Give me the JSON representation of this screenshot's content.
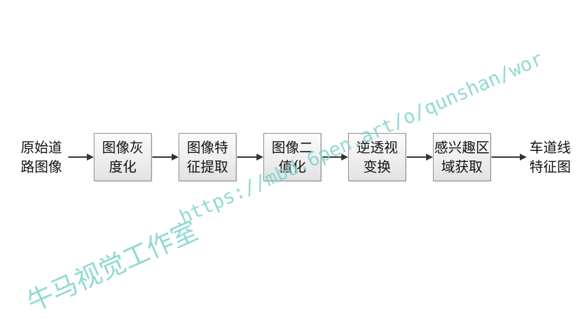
{
  "diagram": {
    "start": {
      "line1": "原始道",
      "line2": "路图像"
    },
    "end": {
      "line1": "车道线",
      "line2": "特征图"
    },
    "steps": [
      {
        "line1": "图像灰",
        "line2": "度化"
      },
      {
        "line1": "图像特",
        "line2": "征提取"
      },
      {
        "line1": "图像二",
        "line2": "值化"
      },
      {
        "line1": "逆透视",
        "line2": "变换"
      },
      {
        "line1": "感兴趣区",
        "line2": "域获取"
      }
    ],
    "colors": {
      "box_border": "#8f8f8f",
      "arrow": "#333333",
      "watermark": "#7fd3cc"
    }
  },
  "watermark": {
    "url": "https://mbd.6pen.art/o/qunshan/wor",
    "cn": "牛马视觉工作室"
  }
}
